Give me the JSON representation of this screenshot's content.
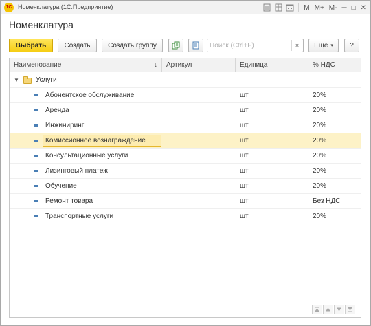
{
  "window": {
    "title": "Номенклатура (1С:Предприятие)",
    "logo_text": "1С",
    "controls": {
      "m": "M",
      "m_plus": "M+",
      "m_minus": "M-",
      "minimize": "─",
      "maximize": "□",
      "close": "✕"
    }
  },
  "page": {
    "title": "Номенклатура"
  },
  "toolbar": {
    "select_label": "Выбрать",
    "create_label": "Создать",
    "create_group_label": "Создать группу",
    "search_placeholder": "Поиск (Ctrl+F)",
    "search_value": "",
    "clear_label": "×",
    "more_label": "Еще",
    "help_label": "?"
  },
  "grid": {
    "columns": {
      "name": "Наименование",
      "sort_indicator": "↓",
      "article": "Артикул",
      "unit": "Единица",
      "vat": "% НДС"
    },
    "group": {
      "name": "Услуги",
      "expanded": true
    },
    "rows": [
      {
        "name": "Абонентское обслуживание",
        "article": "",
        "unit": "шт",
        "vat": "20%"
      },
      {
        "name": "Аренда",
        "article": "",
        "unit": "шт",
        "vat": "20%"
      },
      {
        "name": "Инжиниринг",
        "article": "",
        "unit": "шт",
        "vat": "20%"
      },
      {
        "name": "Комиссионное вознаграждение",
        "article": "",
        "unit": "шт",
        "vat": "20%"
      },
      {
        "name": "Консультационные услуги",
        "article": "",
        "unit": "шт",
        "vat": "20%"
      },
      {
        "name": "Лизинговый платеж",
        "article": "",
        "unit": "шт",
        "vat": "20%"
      },
      {
        "name": "Обучение",
        "article": "",
        "unit": "шт",
        "vat": "20%"
      },
      {
        "name": "Ремонт товара",
        "article": "",
        "unit": "шт",
        "vat": "Без НДС"
      },
      {
        "name": "Транспортные услуги",
        "article": "",
        "unit": "шт",
        "vat": "20%"
      }
    ],
    "selected_row_index": 3
  },
  "colors": {
    "primary_button": "#f5cd14",
    "selected_row": "#fdf2c7",
    "focus_border": "#e5b72e",
    "item_icon": "#4a7fb5"
  }
}
